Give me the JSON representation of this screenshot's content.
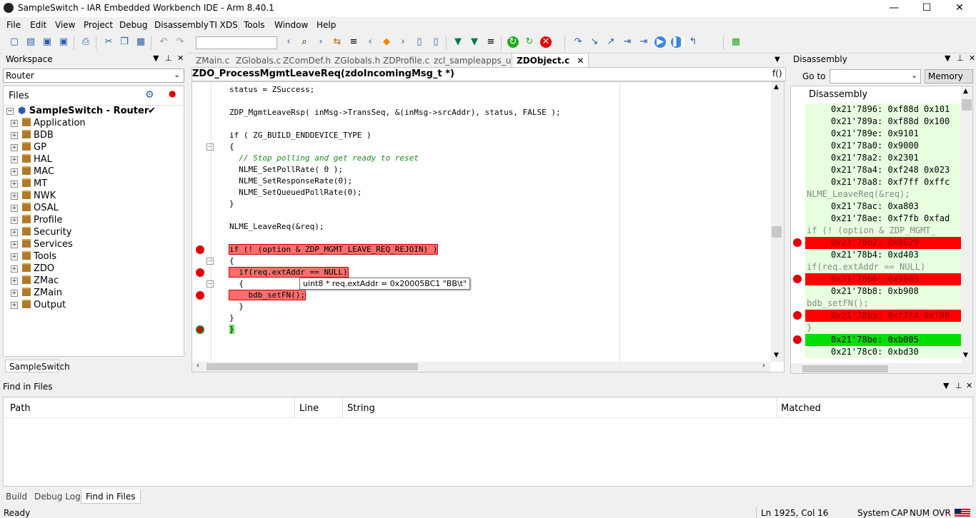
{
  "window": {
    "title": "SampleSwitch - IAR Embedded Workbench IDE - Arm 8.40.1",
    "min": "—",
    "max": "☐",
    "close": "✕"
  },
  "menu": [
    "File",
    "Edit",
    "View",
    "Project",
    "Debug",
    "Disassembly",
    "TI XDS",
    "Tools",
    "Window",
    "Help"
  ],
  "workspace": {
    "title": "Workspace",
    "config": "Router",
    "files_header": "Files",
    "project": "SampleSwitch - Router",
    "folders": [
      "Application",
      "BDB",
      "GP",
      "HAL",
      "MAC",
      "MT",
      "NWK",
      "OSAL",
      "Profile",
      "Security",
      "Services",
      "Tools",
      "ZDO",
      "ZMac",
      "ZMain",
      "Output"
    ],
    "tab": "SampleSwitch"
  },
  "editor": {
    "tabs": [
      "ZMain.c",
      "ZGlobals.c",
      "ZComDef.h",
      "ZGlobals.h",
      "ZDProfile.c",
      "zcl_sampleapps_ui.c",
      "ZDObject.c"
    ],
    "active_tab": "ZDObject.c",
    "function": "ZDO_ProcessMgmtLeaveReq(zdoIncomingMsg_t *)",
    "fx": "f()",
    "lines": [
      "status = ZSuccess;",
      "",
      "ZDP_MgmtLeaveRsp( inMsg->TransSeq, &(inMsg->srcAddr), status, FALSE );",
      "",
      "if ( ZG_BUILD_ENDDEVICE_TYPE )",
      "{",
      "  // Stop polling and get ready to reset",
      "  NLME_SetPollRate( 0 );",
      "  NLME_SetResponseRate(0);",
      "  NLME_SetQueuedPollRate(0);",
      "}",
      "",
      "NLME_LeaveReq(&req);",
      "",
      "if (! (option & ZDP_MGMT_LEAVE_REQ_REJOIN) )",
      "{",
      "  if(req.extAddr == NULL)",
      "  {",
      "    bdb_setFN();",
      "  }",
      "}",
      "}"
    ],
    "tooltip": "uint8 * req.extAddr = 0x20005BC1 \"BB\\t\""
  },
  "disassembly": {
    "title": "Disassembly",
    "goto_label": "Go to",
    "memory_btn": "Memory",
    "header": "Disassembly",
    "rows": [
      {
        "text": "0x21'7896: 0xf88d 0x101",
        "kind": "code"
      },
      {
        "text": "0x21'789a: 0xf88d 0x100",
        "kind": "code"
      },
      {
        "text": "0x21'789e: 0x9101",
        "kind": "code"
      },
      {
        "text": "0x21'78a0: 0x9000",
        "kind": "code"
      },
      {
        "text": "0x21'78a2: 0x2301",
        "kind": "code"
      },
      {
        "text": "0x21'78a4: 0xf248 0x023",
        "kind": "code"
      },
      {
        "text": "0x21'78a8: 0xf7ff 0xffc",
        "kind": "code"
      },
      {
        "text": "NLME_LeaveReq(&req);",
        "kind": "src"
      },
      {
        "text": "0x21'78ac: 0xa803",
        "kind": "code"
      },
      {
        "text": "0x21'78ae: 0xf7fb 0xfad",
        "kind": "code"
      },
      {
        "text": "if (! (option & ZDP_MGMT_",
        "kind": "src"
      },
      {
        "text": "0x21'78b2: 0x0629",
        "kind": "red"
      },
      {
        "text": "0x21'78b4: 0xd403",
        "kind": "code"
      },
      {
        "text": "if(req.extAddr == NULL)",
        "kind": "src"
      },
      {
        "text": "0x21'78b6: 0x9803",
        "kind": "red"
      },
      {
        "text": "0x21'78b8: 0xb908",
        "kind": "code"
      },
      {
        "text": "bdb_setFN();",
        "kind": "src"
      },
      {
        "text": "0x21'78ba: 0xf7f4 0xf90",
        "kind": "red"
      },
      {
        "text": "}",
        "kind": "src"
      },
      {
        "text": "0x21'78be: 0xb005",
        "kind": "cur"
      },
      {
        "text": "0x21'78c0: 0xbd30",
        "kind": "code"
      }
    ]
  },
  "find": {
    "title": "Find in Files",
    "columns": [
      "Path",
      "Line",
      "String",
      "Matched"
    ],
    "tabs": [
      "Build",
      "Debug Log",
      "Find in Files"
    ]
  },
  "status": {
    "left": "Ready",
    "pos": "Ln 1925, Col 16",
    "system": "System",
    "cap": "CAP",
    "num": "NUM",
    "ovr": "OVR"
  }
}
